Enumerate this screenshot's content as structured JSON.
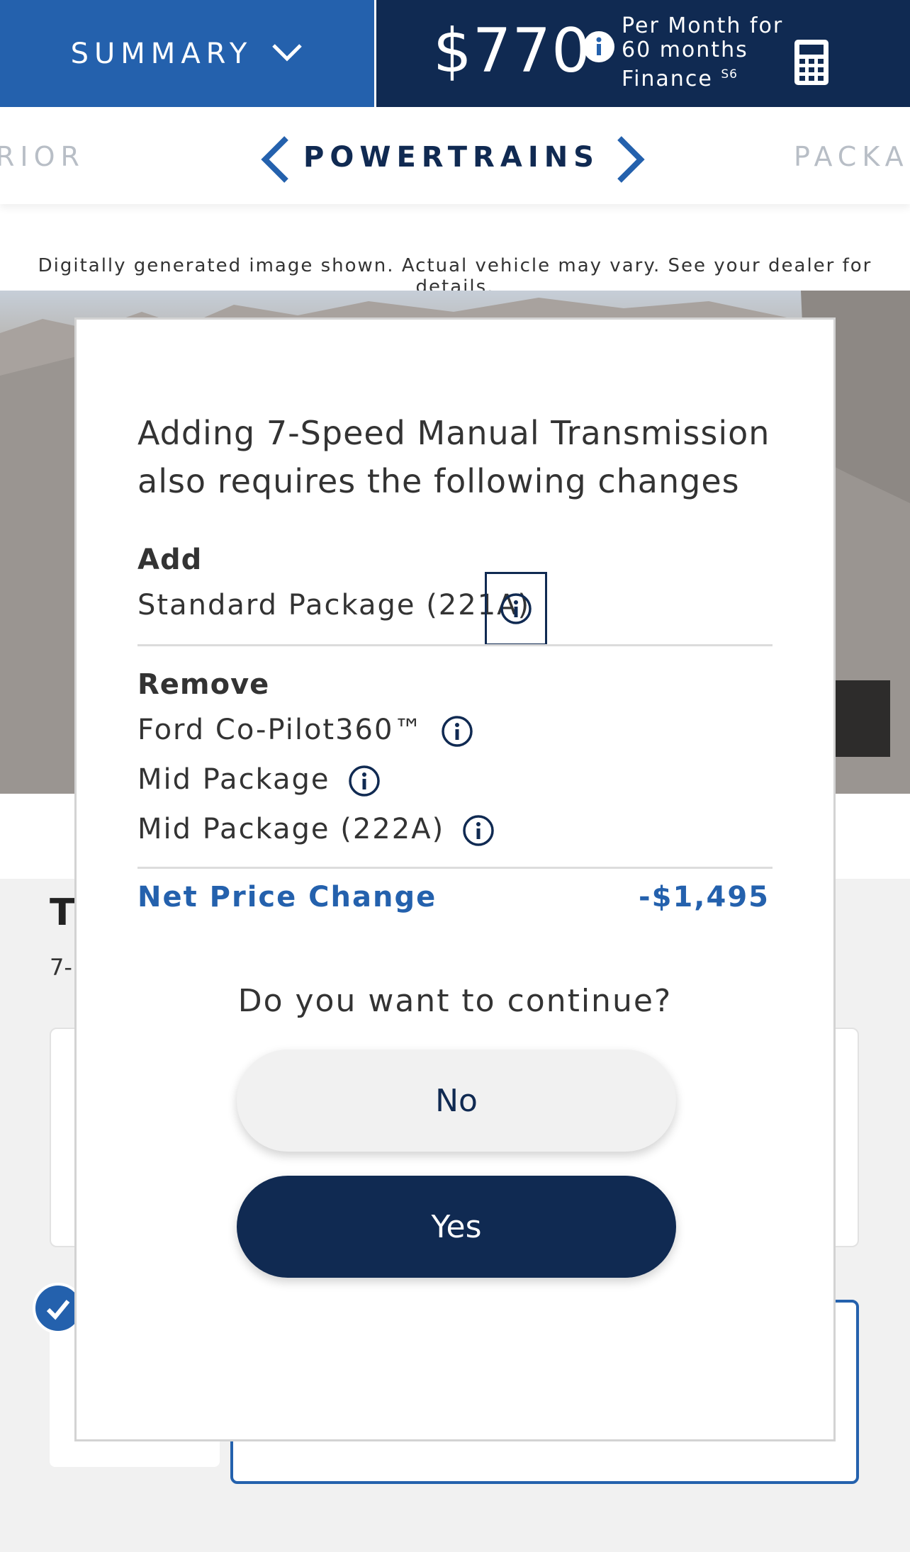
{
  "header": {
    "summary_label": "SUMMARY",
    "price": "$770",
    "price_terms_line1": "Per Month for",
    "price_terms_line2": "60 months",
    "price_terms_line3": "Finance",
    "price_footnote": "S6",
    "icons": [
      "chevron-down-icon",
      "info-icon",
      "calculator-icon"
    ]
  },
  "section_nav": {
    "prev": "RIOR",
    "current": "POWERTRAINS",
    "next": "PACKA"
  },
  "disclaimer": "Digitally generated image shown. Actual vehicle may vary. See your dealer for details.",
  "background_page": {
    "title": "T",
    "subtitle": "7-"
  },
  "modal": {
    "title": "Adding 7-Speed Manual Transmission also requires the following changes",
    "add_label": "Add",
    "add_items": [
      "Standard Package (221A)"
    ],
    "remove_label": "Remove",
    "remove_items": [
      "Ford Co-Pilot360™",
      "Mid Package",
      "Mid Package (222A)"
    ],
    "net_label": "Net Price Change",
    "net_value": "-$1,495",
    "question": "Do you want to continue?",
    "no_label": "No",
    "yes_label": "Yes"
  },
  "colors": {
    "brand_blue": "#2461ad",
    "navy": "#102a52"
  }
}
